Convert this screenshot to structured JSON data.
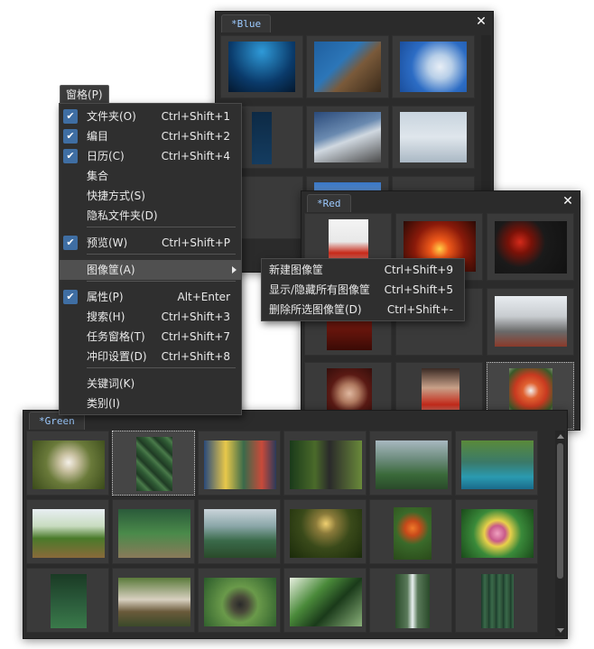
{
  "window_button": {
    "label": "窗格(P)"
  },
  "panels": {
    "blue": {
      "tab": "*Blue",
      "close": "✕"
    },
    "red": {
      "tab": "*Red",
      "close": "✕"
    },
    "green": {
      "tab": "*Green"
    }
  },
  "menu": {
    "items": [
      {
        "label": "文件夹(O)",
        "shortcut": "Ctrl+Shift+1",
        "checked": true
      },
      {
        "label": "编目",
        "shortcut": "Ctrl+Shift+2",
        "checked": true
      },
      {
        "label": "日历(C)",
        "shortcut": "Ctrl+Shift+4",
        "checked": true
      },
      {
        "label": "集合",
        "shortcut": "",
        "checked": false
      },
      {
        "label": "快捷方式(S)",
        "shortcut": "",
        "checked": false
      },
      {
        "label": "隐私文件夹(D)",
        "shortcut": "",
        "checked": false
      },
      {
        "label": "预览(W)",
        "shortcut": "Ctrl+Shift+P",
        "checked": true
      },
      {
        "label": "图像筐(A)",
        "shortcut": "",
        "checked": false,
        "submenu": true
      },
      {
        "label": "属性(P)",
        "shortcut": "Alt+Enter",
        "checked": true
      },
      {
        "label": "搜索(H)",
        "shortcut": "Ctrl+Shift+3",
        "checked": false
      },
      {
        "label": "任务窗格(T)",
        "shortcut": "Ctrl+Shift+7",
        "checked": false
      },
      {
        "label": "冲印设置(D)",
        "shortcut": "Ctrl+Shift+8",
        "checked": false
      },
      {
        "label": "关键词(K)",
        "shortcut": "",
        "checked": false
      },
      {
        "label": "类别(I)",
        "shortcut": "",
        "checked": false
      }
    ]
  },
  "submenu": {
    "items": [
      {
        "label": "新建图像筐",
        "shortcut": "Ctrl+Shift+9"
      },
      {
        "label": "显示/隐藏所有图像筐",
        "shortcut": "Ctrl+Shift+5"
      },
      {
        "label": "删除所选图像筐(D)",
        "shortcut": "Ctrl+Shift+-"
      }
    ]
  },
  "icons": {
    "check": "check-icon",
    "close": "close-icon",
    "submenu_arrow": "chevron-right-icon"
  }
}
